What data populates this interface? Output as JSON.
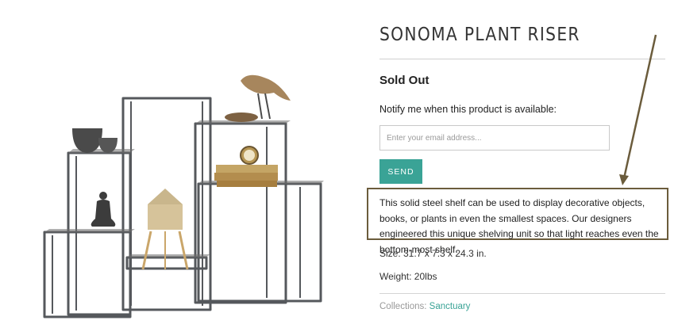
{
  "product": {
    "title": "SONOMA PLANT RISER",
    "status": "Sold Out",
    "notify_text": "Notify me when this product is available:",
    "email_placeholder": "Enter your email address...",
    "send_label": "SEND",
    "description": "This solid steel shelf can be used to display decorative objects, books, or plants in even the smallest spaces. Our designers engineered this unique shelving unit so that light reaches even the bottom-most shelf.",
    "size": "Size: 31.7 x 7.3 x 24.3 in.",
    "weight": "Weight: 20lbs",
    "collections_label": "Collections:",
    "collections_link": "Sanctuary"
  },
  "image": {
    "subject": "steel-shelf-with-decor",
    "items": [
      "bowl-icon",
      "bird-figurine-icon",
      "clock-icon",
      "books-icon",
      "buddha-figurine-icon",
      "water-tower-icon"
    ]
  },
  "colors": {
    "accent": "#3aa396",
    "annotation": "#6b5c3c",
    "text": "#222222",
    "divider": "#cfcfcf"
  }
}
